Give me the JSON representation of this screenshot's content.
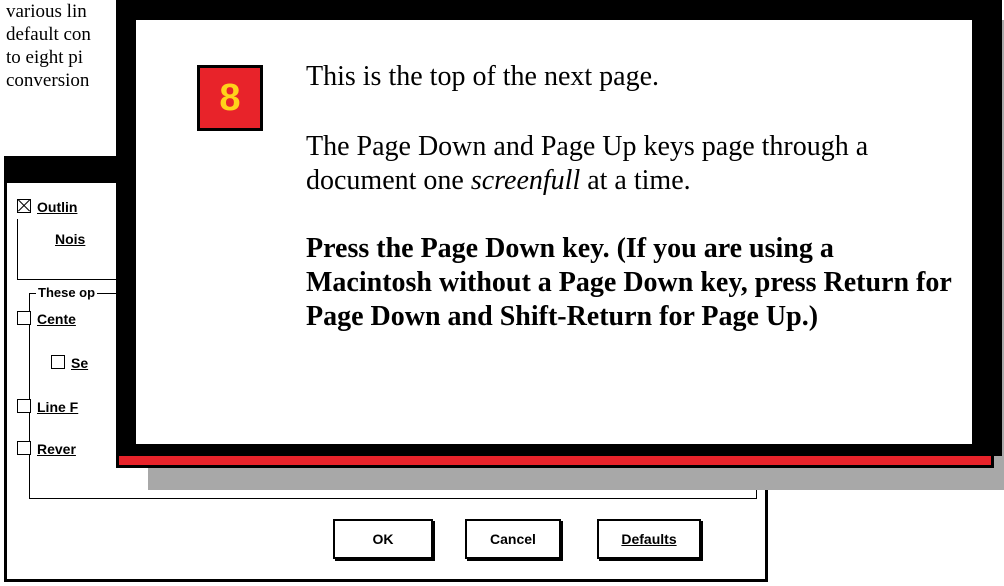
{
  "document": {
    "lines": [
      "various lin",
      "default con",
      "to eight pi",
      "conversion"
    ]
  },
  "dialog": {
    "outline_label": "Outlin",
    "outline_checked": true,
    "noise_label": "Nois",
    "group_label": "These op",
    "center_label": "Cente",
    "sub_label": "Se",
    "line_label": "Line F",
    "reverse_label": "Rever",
    "ok_label": "OK",
    "cancel_label": "Cancel",
    "defaults_label": "Defaults"
  },
  "callout": {
    "step_number": "8",
    "para1": "This is the top of the next page.",
    "para2_prefix": "The Page Down and Page Up keys page through a document one ",
    "para2_em": "screenfull",
    "para2_suffix": " at a time.",
    "para3": "Press the Page Down key. (If you are using a Macintosh without a Page Down key, press Return for Page Down and Shift-Return for Page Up.)"
  },
  "colors": {
    "accent_red": "#e8232a",
    "badge_text": "#ffd21a",
    "shadow_gray": "#a8a8a8"
  }
}
